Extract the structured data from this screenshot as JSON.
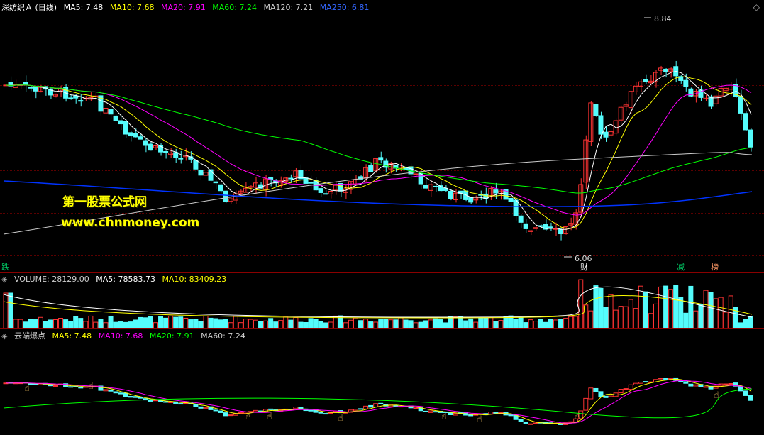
{
  "main_header": {
    "title": "深纺织Ａ (日线)",
    "indicators": [
      {
        "text": "MA5: 7.48",
        "color": "#ffffff"
      },
      {
        "text": "MA10: 7.68",
        "color": "#ffff00"
      },
      {
        "text": "MA20: 7.91",
        "color": "#ff00ff"
      },
      {
        "text": "MA60: 7.24",
        "color": "#00ff00"
      },
      {
        "text": "MA120: 7.21",
        "color": "#cccccc"
      },
      {
        "text": "MA250: 6.81",
        "color": "#0033ff"
      }
    ]
  },
  "price_marks": {
    "high": "8.84",
    "low": "6.06"
  },
  "watermark": {
    "line1": "第一股票公式网",
    "line2": "www.chnmoney.com"
  },
  "event_tags": [
    {
      "text": "跌",
      "color": "#00cc66"
    },
    {
      "text": "财",
      "color": "#ffffff"
    },
    {
      "text": "减",
      "color": "#00cc66"
    },
    {
      "text": "榜",
      "color": "#ff9966"
    }
  ],
  "volume_header": [
    {
      "text": "VOLUME: 28129.00",
      "color": "#cccccc"
    },
    {
      "text": "MA5: 78583.73",
      "color": "#ffffff"
    },
    {
      "text": "MA10: 83409.23",
      "color": "#ffff00"
    }
  ],
  "indicator_header": {
    "title": "云端爆点",
    "items": [
      {
        "text": "MA5: 7.48",
        "color": "#ffff00"
      },
      {
        "text": "MA10: 7.68",
        "color": "#ff00ff"
      },
      {
        "text": "MA20: 7.91",
        "color": "#00ff00"
      },
      {
        "text": "MA60: 7.24",
        "color": "#cccccc"
      }
    ]
  },
  "colors": {
    "up": "#ff3333",
    "down": "#54fcfc",
    "grid": "#5a0000"
  }
}
